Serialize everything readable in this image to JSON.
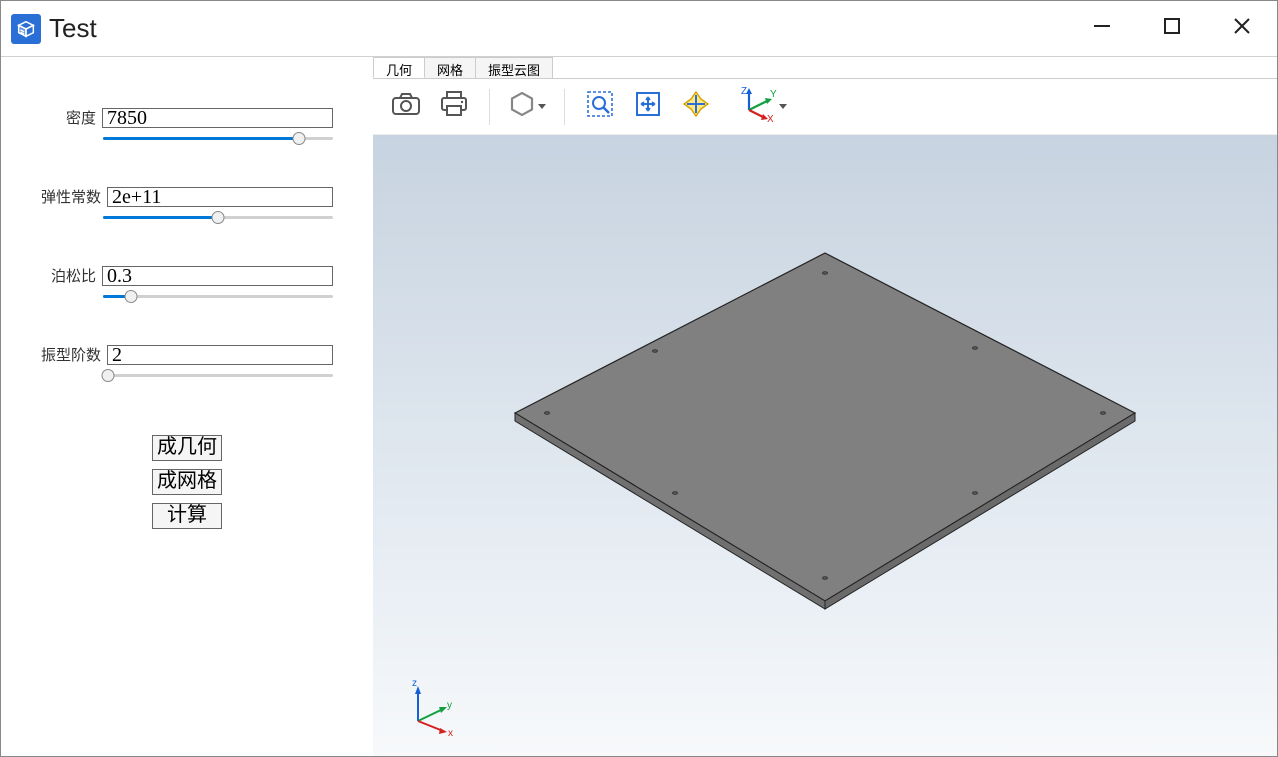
{
  "window": {
    "title": "Test"
  },
  "sidebar": {
    "params": [
      {
        "label": "密度",
        "value": "7850",
        "slider_pct": 85
      },
      {
        "label": "弹性常数",
        "value": "2e+11",
        "slider_pct": 50
      },
      {
        "label": "泊松比",
        "value": "0.3",
        "slider_pct": 12
      },
      {
        "label": "振型阶数",
        "value": "2",
        "slider_pct": 2
      }
    ],
    "buttons": [
      {
        "label": "成几何"
      },
      {
        "label": "成网格"
      },
      {
        "label": "计算"
      }
    ]
  },
  "tabs": [
    {
      "label": "几何",
      "active": true
    },
    {
      "label": "网格",
      "active": false
    },
    {
      "label": "振型云图",
      "active": false
    }
  ],
  "toolbar_icons": {
    "camera": "camera-icon",
    "print": "print-icon",
    "hex": "hex-icon",
    "zoom_select": "zoom-select-icon",
    "fit": "fit-icon",
    "cross": "cross-icon",
    "axes": "axes-icon"
  },
  "triad": {
    "x": "x",
    "y": "y",
    "z": "z"
  },
  "large_axes": {
    "x": "X",
    "y": "Y",
    "z": "Z"
  }
}
